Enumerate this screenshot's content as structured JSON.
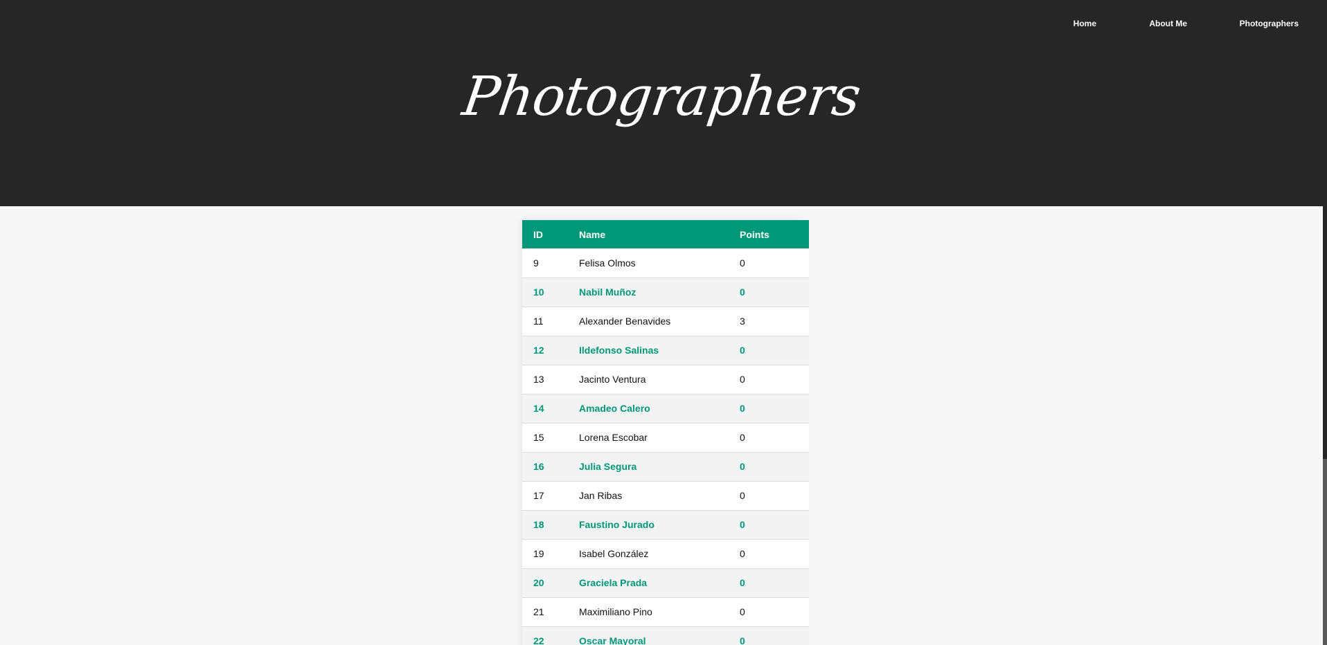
{
  "nav": {
    "items": [
      {
        "label": "Home"
      },
      {
        "label": "About Me"
      },
      {
        "label": "Photographers"
      }
    ]
  },
  "header": {
    "title": "Photographers"
  },
  "table": {
    "headers": [
      "ID",
      "Name",
      "Points"
    ],
    "rows": [
      {
        "id": "9",
        "name": "Felisa Olmos",
        "points": "0"
      },
      {
        "id": "10",
        "name": "Nabil Muñoz",
        "points": "0"
      },
      {
        "id": "11",
        "name": "Alexander Benavides",
        "points": "3"
      },
      {
        "id": "12",
        "name": "Ildefonso Salinas",
        "points": "0"
      },
      {
        "id": "13",
        "name": "Jacinto Ventura",
        "points": "0"
      },
      {
        "id": "14",
        "name": "Amadeo Calero",
        "points": "0"
      },
      {
        "id": "15",
        "name": "Lorena Escobar",
        "points": "0"
      },
      {
        "id": "16",
        "name": "Julia Segura",
        "points": "0"
      },
      {
        "id": "17",
        "name": "Jan Ribas",
        "points": "0"
      },
      {
        "id": "18",
        "name": "Faustino Jurado",
        "points": "0"
      },
      {
        "id": "19",
        "name": "Isabel González",
        "points": "0"
      },
      {
        "id": "20",
        "name": "Graciela Prada",
        "points": "0"
      },
      {
        "id": "21",
        "name": "Maximiliano Pino",
        "points": "0"
      },
      {
        "id": "22",
        "name": "Oscar Mayoral",
        "points": "0"
      }
    ]
  },
  "colors": {
    "header_background": "#262626",
    "accent": "#009879",
    "page_background": "#f7f7f7"
  }
}
